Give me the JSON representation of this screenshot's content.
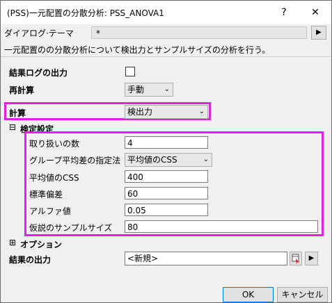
{
  "window": {
    "title": "(PSS)一元配置の分散分析: PSS_ANOVA1",
    "help_glyph": "?",
    "close_glyph": "✕"
  },
  "theme": {
    "label": "ダイアログ·テーマ",
    "value": "*",
    "arrow": "▶"
  },
  "description": "一元配置のの分散分析について検出力とサンプルサイズの分析を行う。",
  "form": {
    "log_output_label": "結果ログの出力",
    "recalc_label": "再計算",
    "recalc_value": "手動",
    "calc_label": "計算",
    "calc_value": "検出力",
    "test_settings_label": "検定設定",
    "test_settings_expander": "⊟",
    "num_treatments_label": "取り扱いの数",
    "num_treatments_value": "4",
    "group_mean_method_label": "グループ平均差の指定法",
    "group_mean_method_value": "平均値のCSS",
    "css_label": "平均値のCSS",
    "css_value": "400",
    "std_dev_label": "標準偏差",
    "std_dev_value": "60",
    "alpha_label": "アルファ値",
    "alpha_value": "0.05",
    "sample_size_label": "仮説のサンプルサイズ",
    "sample_size_value": "80",
    "options_label": "オプション",
    "options_expander": "⊞",
    "output_label": "結果の出力",
    "output_value": "<新規>",
    "output_arrow": "▶"
  },
  "buttons": {
    "ok": "OK",
    "cancel": "キャンセル"
  },
  "colors": {
    "highlight": "#e61ee6",
    "default_button_border": "#0078d7"
  }
}
